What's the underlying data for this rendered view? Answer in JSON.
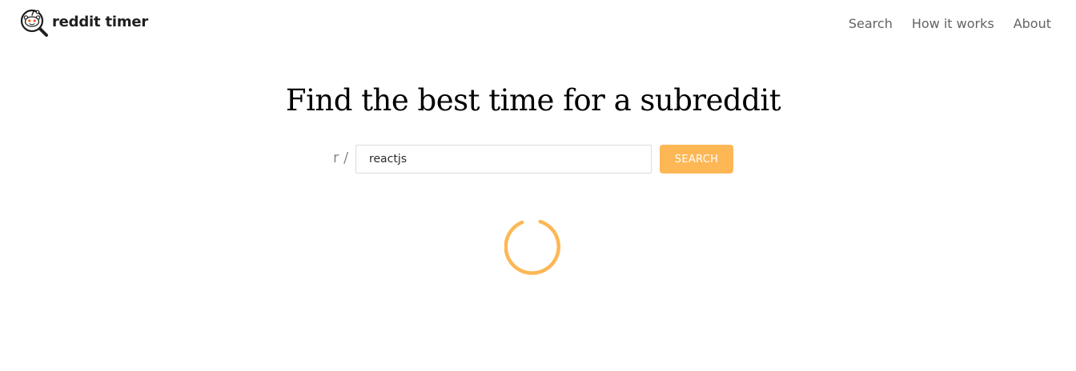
{
  "header": {
    "logo_text": "reddit timer",
    "nav": [
      {
        "label": "Search"
      },
      {
        "label": "How it works"
      },
      {
        "label": "About"
      }
    ]
  },
  "main": {
    "title": "Find the best time for a subreddit",
    "search": {
      "prefix": "r /",
      "value": "reactjs",
      "button_label": "SEARCH"
    },
    "loading": true
  },
  "colors": {
    "accent": "#fdb755",
    "nav_text": "#636363",
    "prefix_text": "#8a8a8a"
  }
}
